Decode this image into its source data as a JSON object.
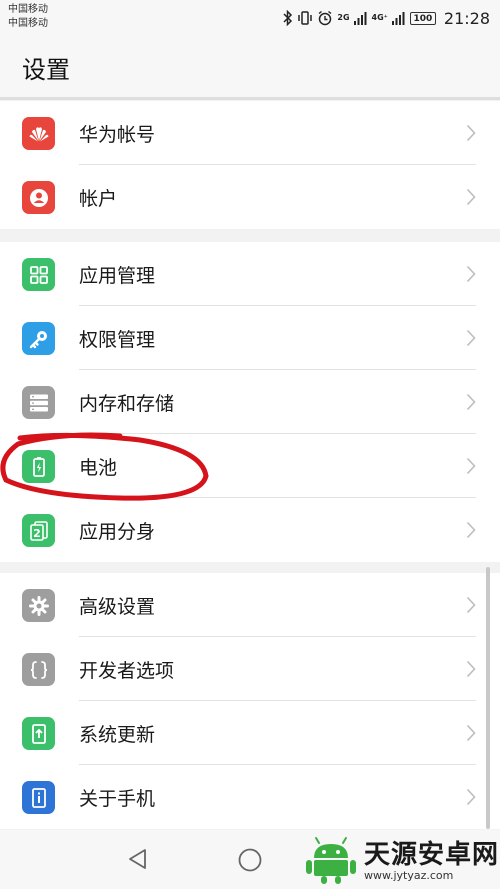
{
  "status_bar": {
    "carrier_1": "中国移动",
    "carrier_2": "中国移动",
    "net_2g": "2G",
    "net_4g": "4G⁺",
    "battery": "100",
    "time": "21:28"
  },
  "header": {
    "title": "设置"
  },
  "groups": [
    {
      "items": [
        {
          "label": "华为帐号",
          "icon": "huawei-logo-icon",
          "color": "#e8453c"
        },
        {
          "label": "帐户",
          "icon": "account-icon",
          "color": "#e8453c"
        }
      ]
    },
    {
      "items": [
        {
          "label": "应用管理",
          "icon": "app-grid-icon",
          "color": "#3cbf6b"
        },
        {
          "label": "权限管理",
          "icon": "key-icon",
          "color": "#2e9ee6"
        },
        {
          "label": "内存和存储",
          "icon": "storage-icon",
          "color": "#9e9e9e"
        },
        {
          "label": "电池",
          "icon": "battery-icon",
          "color": "#3cbf6b"
        },
        {
          "label": "应用分身",
          "icon": "app-twin-icon",
          "color": "#3cbf6b"
        }
      ]
    },
    {
      "items": [
        {
          "label": "高级设置",
          "icon": "gear-icon",
          "color": "#9e9e9e"
        },
        {
          "label": "开发者选项",
          "icon": "braces-icon",
          "color": "#9e9e9e"
        },
        {
          "label": "系统更新",
          "icon": "system-update-icon",
          "color": "#3cbf6b"
        },
        {
          "label": "关于手机",
          "icon": "phone-info-icon",
          "color": "#2e74d6"
        }
      ]
    }
  ],
  "annotation": {
    "color": "#d4131b"
  },
  "watermark": {
    "title": "天源安卓网",
    "url": "www.jytyaz.com"
  }
}
